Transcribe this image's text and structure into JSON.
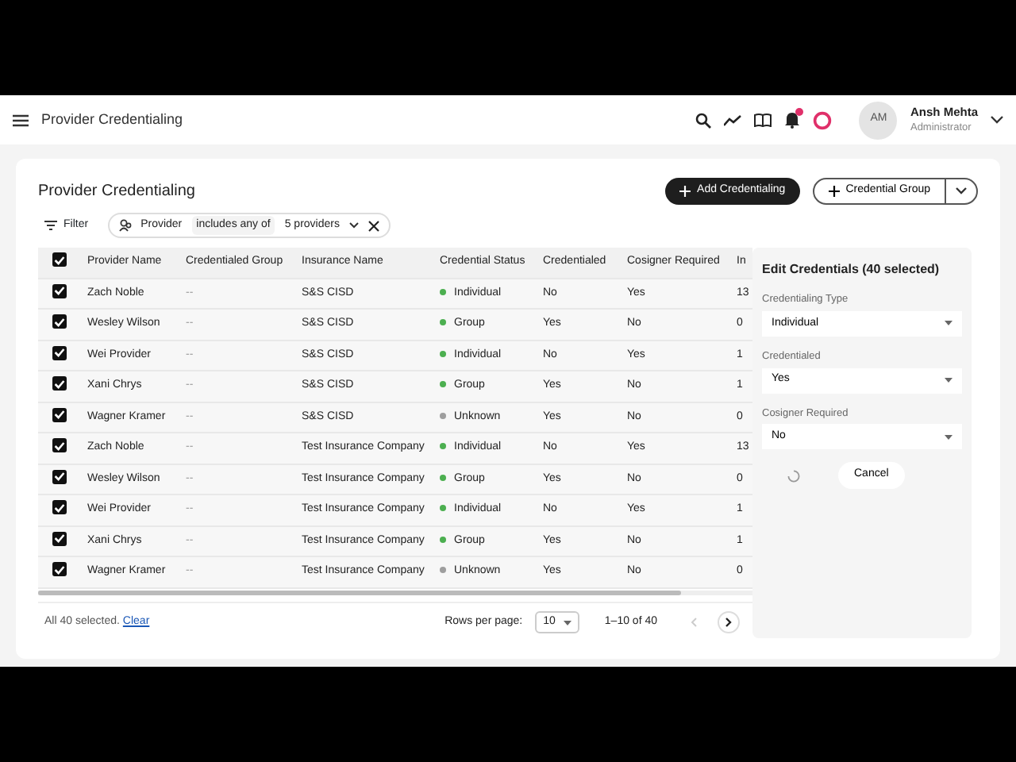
{
  "header": {
    "title": "Provider Credentialing",
    "user": {
      "initials": "AM",
      "name": "Ansh Mehta",
      "role": "Administrator"
    },
    "notification_badge": true
  },
  "page": {
    "title": "Provider Credentialing",
    "buttons": [
      {
        "label": "Add Credentialing",
        "kind": "primary"
      },
      {
        "label": "Credential Group",
        "kind": "split"
      }
    ]
  },
  "filter": {
    "label": "Filter",
    "chip": {
      "field": "Provider",
      "operator": "includes any of",
      "value": "5 providers"
    }
  },
  "table": {
    "all_checked": true,
    "columns": [
      "Provider Name",
      "Credentialed Group",
      "Insurance Name",
      "Credential Status",
      "Credentialed",
      "Cosigner Required",
      "In"
    ],
    "rows": [
      {
        "checked": true,
        "cells": [
          "Zach Noble",
          "--",
          "S&S CISD",
          "Individual",
          "No",
          "Yes",
          "13"
        ],
        "color": "#4caf50"
      },
      {
        "checked": true,
        "cells": [
          "Wesley Wilson",
          "--",
          "S&S CISD",
          "Group",
          "Yes",
          "No",
          "0"
        ],
        "color": "#4caf50"
      },
      {
        "checked": true,
        "cells": [
          "Wei Provider",
          "--",
          "S&S CISD",
          "Individual",
          "No",
          "Yes",
          "1"
        ],
        "color": "#4caf50"
      },
      {
        "checked": true,
        "cells": [
          "Xani Chrys",
          "--",
          "S&S CISD",
          "Group",
          "Yes",
          "No",
          "1"
        ],
        "color": "#4caf50"
      },
      {
        "checked": true,
        "cells": [
          "Wagner Kramer",
          "--",
          "S&S CISD",
          "Unknown",
          "Yes",
          "No",
          "0"
        ],
        "color": "#9e9e9e"
      },
      {
        "checked": true,
        "cells": [
          "Zach Noble",
          "--",
          "Test Insurance Company",
          "Individual",
          "No",
          "Yes",
          "13"
        ],
        "color": "#4caf50"
      },
      {
        "checked": true,
        "cells": [
          "Wesley Wilson",
          "--",
          "Test Insurance Company",
          "Group",
          "Yes",
          "No",
          "0"
        ],
        "color": "#4caf50"
      },
      {
        "checked": true,
        "cells": [
          "Wei Provider",
          "--",
          "Test Insurance Company",
          "Individual",
          "No",
          "Yes",
          "1"
        ],
        "color": "#4caf50"
      },
      {
        "checked": true,
        "cells": [
          "Xani Chrys",
          "--",
          "Test Insurance Company",
          "Group",
          "Yes",
          "No",
          "1"
        ],
        "color": "#4caf50"
      },
      {
        "checked": true,
        "cells": [
          "Wagner Kramer",
          "--",
          "Test Insurance Company",
          "Unknown",
          "Yes",
          "No",
          "0"
        ],
        "color": "#9e9e9e"
      }
    ]
  },
  "footer": {
    "selection": "All 40 selected.",
    "clear": "Clear",
    "rows_per_page_label": "Rows per page:",
    "rows_per_page": "10",
    "range": "1–10 of 40"
  },
  "panel": {
    "title": "Edit Credentials (40 selected)",
    "fields": [
      {
        "label": "Credentialing Type",
        "value": "Individual"
      },
      {
        "label": "Credentialed",
        "value": "Yes"
      },
      {
        "label": "Cosigner Required",
        "value": "No"
      }
    ],
    "loading": true,
    "cancel": "Cancel"
  }
}
